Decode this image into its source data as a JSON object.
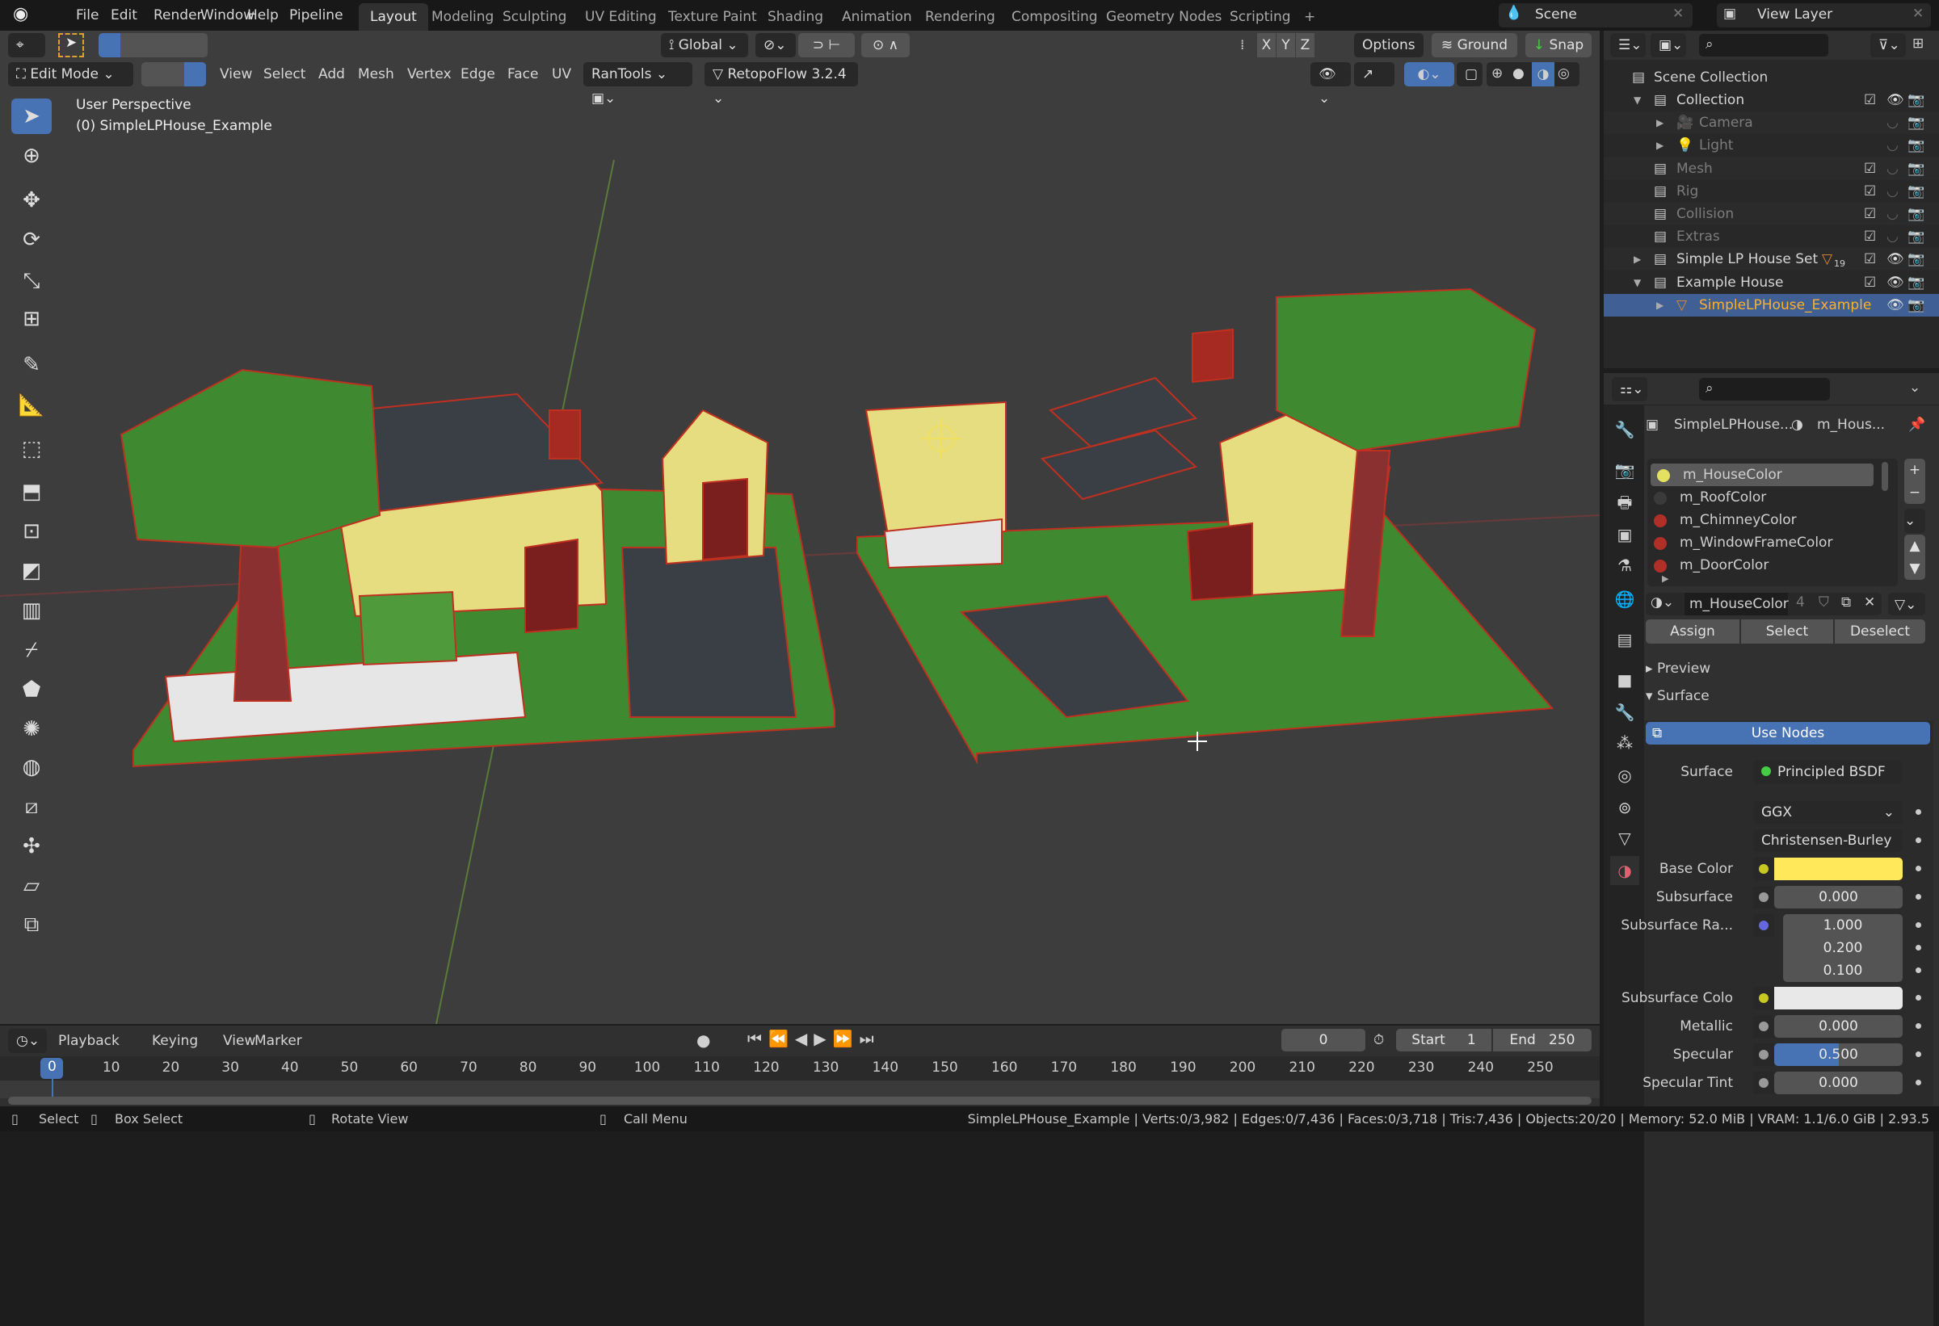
{
  "topbar": {
    "menus": [
      "File",
      "Edit",
      "Render",
      "Window",
      "Help",
      "Pipeline"
    ],
    "workspaces": [
      "Layout",
      "Modeling",
      "Sculpting",
      "UV Editing",
      "Texture Paint",
      "Shading",
      "Animation",
      "Rendering",
      "Compositing",
      "Geometry Nodes",
      "Scripting"
    ],
    "add_tab": "+",
    "scene": "Scene",
    "view_layer": "View Layer"
  },
  "tool_header": {
    "orientation": "Global",
    "axes": [
      "X",
      "Y",
      "Z"
    ],
    "options": "Options",
    "ground": "Ground",
    "snap": "Snap"
  },
  "view_header": {
    "mode": "Edit Mode",
    "menus": [
      "View",
      "Select",
      "Add",
      "Mesh",
      "Vertex",
      "Edge",
      "Face",
      "UV"
    ],
    "rantools": "RanTools",
    "retopoflow": "RetopoFlow 3.2.4"
  },
  "viewport": {
    "perspective": "User Perspective",
    "object": "(0) SimpleLPHouse_Example"
  },
  "outliner": {
    "root": "Scene Collection",
    "items": [
      {
        "label": "Collection",
        "level": 1,
        "dim": false
      },
      {
        "label": "Camera",
        "level": 2,
        "dim": true
      },
      {
        "label": "Light",
        "level": 2,
        "dim": true
      },
      {
        "label": "Mesh",
        "level": 1,
        "dim": true
      },
      {
        "label": "Rig",
        "level": 1,
        "dim": true
      },
      {
        "label": "Collision",
        "level": 1,
        "dim": true
      },
      {
        "label": "Extras",
        "level": 1,
        "dim": true
      },
      {
        "label": "Simple LP House Set",
        "level": 1,
        "dim": false
      },
      {
        "label": "Example House",
        "level": 1,
        "dim": false
      },
      {
        "label": "SimpleLPHouse_Example",
        "level": 2,
        "dim": false
      }
    ],
    "set_badge": "19"
  },
  "properties": {
    "breadcrumb_object": "SimpleLPHouse...",
    "breadcrumb_material": "m_Hous...",
    "materials": [
      {
        "name": "m_HouseColor",
        "color": "#e4e060"
      },
      {
        "name": "m_RoofColor",
        "color": "#3a3a3a"
      },
      {
        "name": "m_ChimneyColor",
        "color": "#b03028"
      },
      {
        "name": "m_WindowFrameColor",
        "color": "#b03028"
      },
      {
        "name": "m_DoorColor",
        "color": "#b03028"
      }
    ],
    "active_material": "m_HouseColor",
    "users": "4",
    "assign": "Assign",
    "select": "Select",
    "deselect": "Deselect",
    "preview": "Preview",
    "surface_panel": "Surface",
    "use_nodes": "Use Nodes",
    "surface_label": "Surface",
    "surface_value": "Principled BSDF",
    "distribution": "GGX",
    "subsurface_method": "Christensen-Burley",
    "base_color_label": "Base Color",
    "base_color": "#ffe95a",
    "subsurface_label": "Subsurface",
    "subsurface": "0.000",
    "subsurface_radius_label": "Subsurface Ra...",
    "subsurface_radius": [
      "1.000",
      "0.200",
      "0.100"
    ],
    "subsurface_color_label": "Subsurface Colo",
    "subsurface_color": "#e8e8e8",
    "metallic_label": "Metallic",
    "metallic": "0.000",
    "specular_label": "Specular",
    "specular": "0.500",
    "specular_fraction": 0.5,
    "specular_tint_label": "Specular Tint",
    "specular_tint": "0.000"
  },
  "timeline": {
    "menus": [
      "Playback",
      "Keying",
      "View",
      "Marker"
    ],
    "current_frame": "0",
    "start_label": "Start",
    "start": "1",
    "end_label": "End",
    "end": "250",
    "ticks": [
      "0",
      "10",
      "20",
      "30",
      "40",
      "50",
      "60",
      "70",
      "80",
      "90",
      "100",
      "110",
      "120",
      "130",
      "140",
      "150",
      "160",
      "170",
      "180",
      "190",
      "200",
      "210",
      "220",
      "230",
      "240",
      "250"
    ]
  },
  "status": {
    "select": "Select",
    "box_select": "Box Select",
    "rotate_view": "Rotate View",
    "call_menu": "Call Menu",
    "stats": "SimpleLPHouse_Example | Verts:0/3,982 | Edges:0/7,436 | Faces:0/3,718 | Tris:7,436 | Objects:20/20 | Memory: 52.0 MiB | VRAM: 1.1/6.0 GiB | 2.93.5"
  },
  "colors": {
    "accent": "#4772b3",
    "selection": "#e06030",
    "grass": "#4d9a3a",
    "wall": "#e6dc80"
  }
}
